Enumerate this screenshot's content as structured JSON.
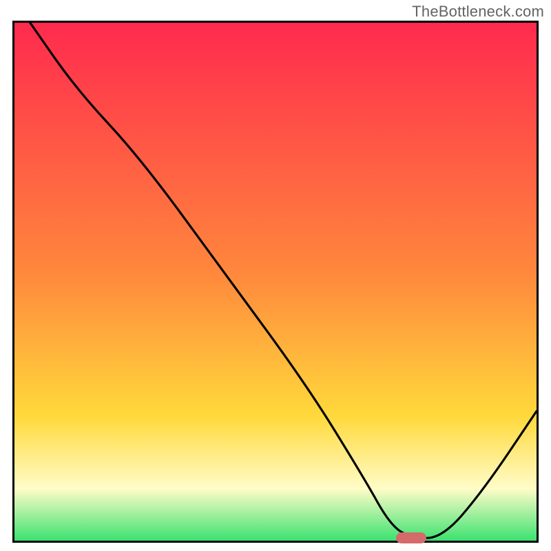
{
  "watermark": "TheBottleneck.com",
  "colors": {
    "top": "#ff2a4e",
    "mid1": "#ff873c",
    "mid2": "#ffd93b",
    "cream": "#fffcc8",
    "green": "#3be270",
    "curve": "#000000",
    "marker": "#d46a6a",
    "border": "#000000"
  },
  "chart_data": {
    "type": "line",
    "title": "",
    "xlabel": "",
    "ylabel": "",
    "xlim": [
      0,
      100
    ],
    "ylim": [
      0,
      100
    ],
    "x": [
      3,
      12,
      24,
      40,
      56,
      67,
      72,
      76,
      82,
      90,
      100
    ],
    "values": [
      100,
      87,
      74,
      52,
      30,
      12,
      3,
      0.5,
      0.5,
      10,
      25
    ],
    "marker": {
      "x": 76,
      "y": 0.5
    },
    "gradient_stops": [
      {
        "pct": 0,
        "color": "#ff2a4e"
      },
      {
        "pct": 48,
        "color": "#ff873c"
      },
      {
        "pct": 76,
        "color": "#ffd93b"
      },
      {
        "pct": 90,
        "color": "#fffcc8"
      },
      {
        "pct": 100,
        "color": "#3be270"
      }
    ]
  }
}
